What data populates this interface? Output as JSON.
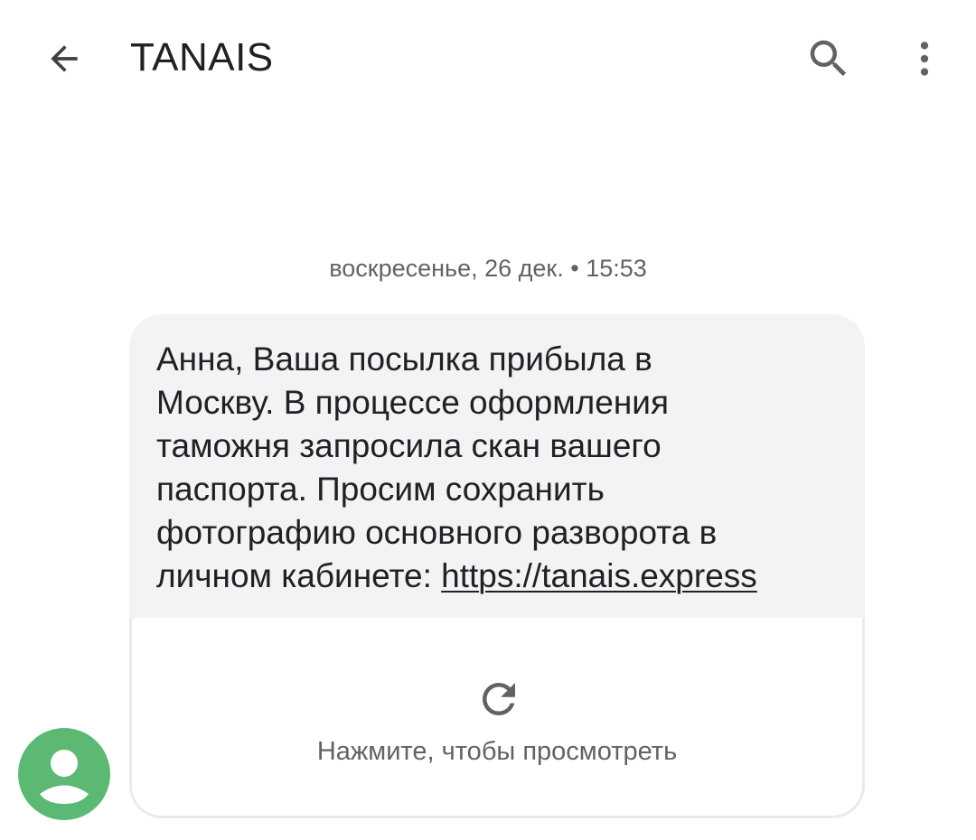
{
  "appbar": {
    "back_icon": "arrow-back-icon",
    "title": "TANAIS",
    "search_icon": "search-icon",
    "more_icon": "more-vert-icon"
  },
  "conversation": {
    "timestamp": "воскресенье, 26 дек. • 15:53",
    "message": {
      "avatar_icon": "person-icon",
      "avatar_color": "#5bb974",
      "lines": [
        "Анна, Ваша посылка прибыла в",
        "Москву. В процессе оформления",
        "таможня запросила скан вашего",
        "паспорта. Просим сохранить",
        "фотографию основного разворота в"
      ],
      "last_line_prefix": "личном кабинете: ",
      "link_text": "https://tanais.express",
      "preview": {
        "refresh_icon": "refresh-icon",
        "tap_label": "Нажмите, чтобы просмотреть"
      }
    }
  },
  "colors": {
    "bubble_background": "#f1f3f4",
    "text_primary": "#202124",
    "text_secondary": "#5f6368"
  }
}
